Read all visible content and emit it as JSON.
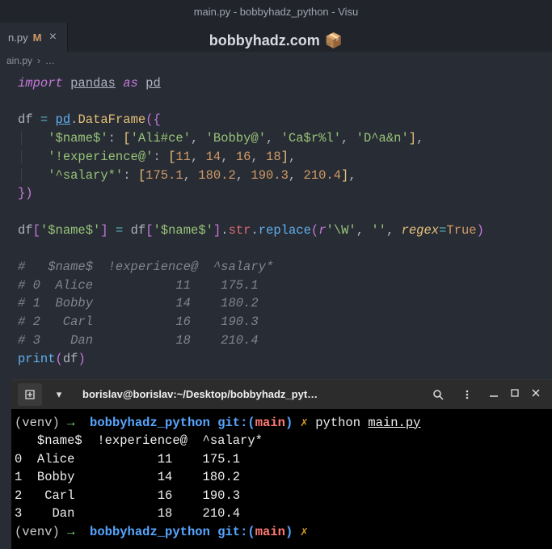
{
  "window": {
    "title": "main.py - bobbyhadz_python - Visu"
  },
  "watermark": {
    "text": "bobbyhadz.com",
    "icon": "📦"
  },
  "tab": {
    "file": "n.py",
    "modified_marker": "M",
    "close": "×"
  },
  "breadcrumb": {
    "file": "ain.py",
    "sep": "›",
    "more": "…"
  },
  "code": {
    "l1_import": "import",
    "l1_pandas": "pandas",
    "l1_as": "as",
    "l1_pd": "pd",
    "l3_df": "df",
    "l3_eq": "=",
    "l3_pd": "pd",
    "l3_dot": ".",
    "l3_DataFrame": "DataFrame",
    "l3_open": "({",
    "l4_key": "'$name$'",
    "l4_colon": ":",
    "l4_vals": [
      "'Ali#ce'",
      "'Bobby@'",
      "'Ca$r%l'",
      "'D^a&n'"
    ],
    "l5_key": "'!experience@'",
    "l5_vals": [
      "11",
      "14",
      "16",
      "18"
    ],
    "l6_key": "'^salary*'",
    "l6_vals": [
      "175.1",
      "180.2",
      "190.3",
      "210.4"
    ],
    "l7_close": "})",
    "l9_df": "df",
    "l9_key": "'$name$'",
    "l9_str": "str",
    "l9_replace": "replace",
    "l9_pattern_prefix": "r",
    "l9_pattern": "'\\W'",
    "l9_empty": "''",
    "l9_regex_kw": "regex",
    "l9_true": "True",
    "comments": {
      "header": "#   $name$  !experience@  ^salary*",
      "r0": "# 0  Alice           11    175.1",
      "r1": "# 1  Bobby           14    180.2",
      "r2": "# 2   Carl           16    190.3",
      "r3": "# 3    Dan           18    210.4"
    },
    "l16_print": "print",
    "l16_arg": "df"
  },
  "terminal": {
    "titlebar": {
      "title": "borislav@borislav:~/Desktop/bobbyhadz_pyt…",
      "dropdown": "▾",
      "newtab": "⊞"
    },
    "prompt": {
      "venv": "(venv)",
      "arrow": "→",
      "dir": "bobbyhadz_python",
      "git": "git:",
      "open": "(",
      "branch": "main",
      "close": ")",
      "x": "✗"
    },
    "cmd": {
      "python": "python",
      "file": "main.py"
    },
    "output": {
      "header": "   $name$  !experience@  ^salary*",
      "rows": [
        "0  Alice           11    175.1",
        "1  Bobby           14    180.2",
        "2   Carl           16    190.3",
        "3    Dan           18    210.4"
      ]
    }
  }
}
